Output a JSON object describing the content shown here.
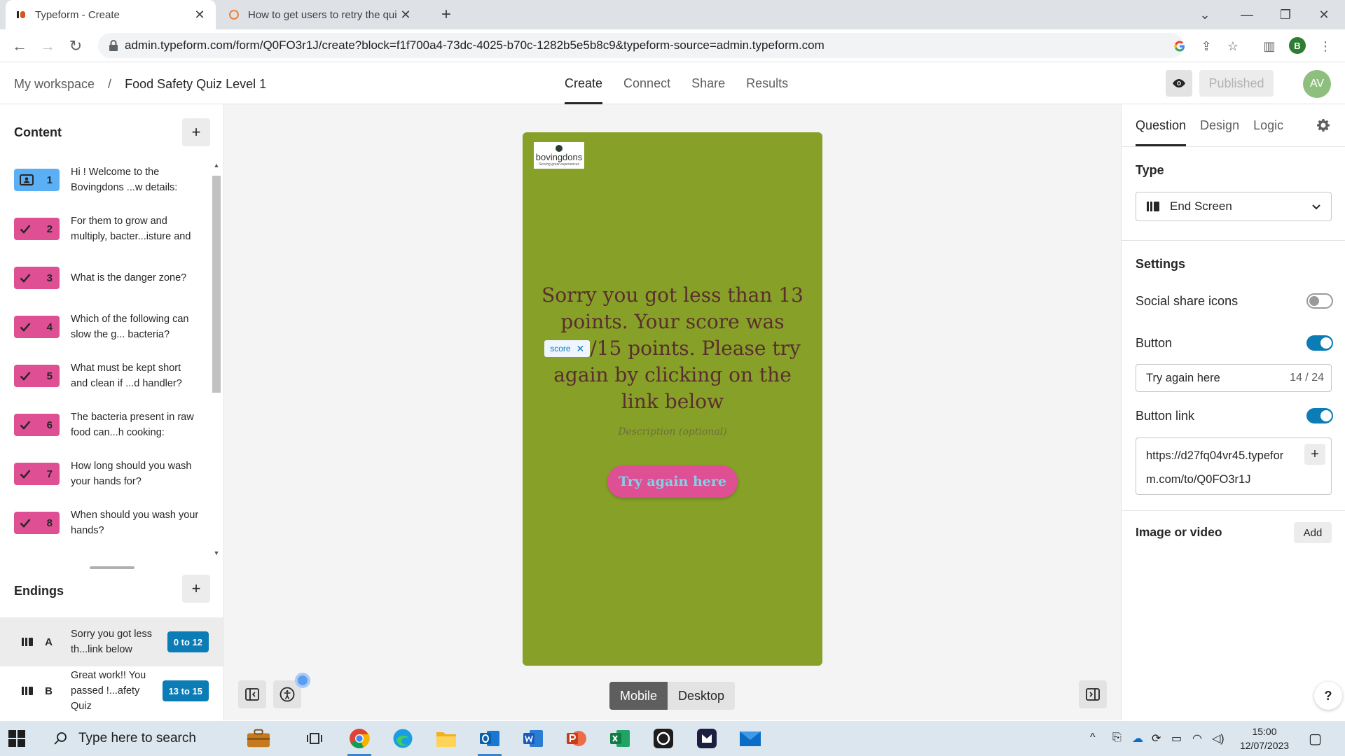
{
  "browser": {
    "tabs": [
      {
        "title": "Typeform - Create",
        "active": true
      },
      {
        "title": "How to get users to retry the qui",
        "active": false
      }
    ],
    "url": "admin.typeform.com/form/Q0FO3r1J/create?block=f1f700a4-73dc-4025-b70c-1282b5e5b8c9&typeform-source=admin.typeform.com",
    "profile_initial": "B"
  },
  "header": {
    "workspace": "My workspace",
    "separator": "/",
    "form_name": "Food Safety Quiz Level 1",
    "tabs": [
      "Create",
      "Connect",
      "Share",
      "Results"
    ],
    "active_tab": "Create",
    "published_label": "Published",
    "avatar_initials": "AV"
  },
  "content": {
    "heading": "Content",
    "add_label": "+",
    "questions": [
      {
        "num": "1",
        "text": "Hi ! Welcome to the Bovingdons ...w details:",
        "kind": "contact"
      },
      {
        "num": "2",
        "text": "For them to grow and multiply, bacter...isture and",
        "kind": "check"
      },
      {
        "num": "3",
        "text": "What is the danger zone?",
        "kind": "check"
      },
      {
        "num": "4",
        "text": "Which of the following can slow the g... bacteria?",
        "kind": "check"
      },
      {
        "num": "5",
        "text": "What must be kept short and clean if ...d handler?",
        "kind": "check"
      },
      {
        "num": "6",
        "text": "The bacteria present in raw food can...h cooking:",
        "kind": "check"
      },
      {
        "num": "7",
        "text": "How long should you wash your hands for?",
        "kind": "check"
      },
      {
        "num": "8",
        "text": "When should you wash your hands?",
        "kind": "check"
      }
    ]
  },
  "endings": {
    "heading": "Endings",
    "add_label": "+",
    "items": [
      {
        "letter": "A",
        "text": "Sorry you got less th...link below",
        "range": "0 to 12"
      },
      {
        "letter": "B",
        "text": "Great work!! You passed !...afety Quiz",
        "range": "13 to 15"
      }
    ]
  },
  "preview": {
    "logo_text": "bovingdons",
    "logo_tagline": "Serving great experiences",
    "line1": "Sorry you got less than 13 points. Your score was",
    "score_chip": "score",
    "line2": "/15 points.",
    "line3": "Please try again by clicking on the link below",
    "description_placeholder": "Description (optional)",
    "button_label": "Try again here",
    "background_color": "#86a028",
    "button_color": "#de4f94"
  },
  "view_toggle": {
    "mobile": "Mobile",
    "desktop": "Desktop",
    "selected": "Mobile"
  },
  "right_panel": {
    "tabs": [
      "Question",
      "Design",
      "Logic"
    ],
    "active_tab": "Question",
    "type_label": "Type",
    "type_value": "End Screen",
    "settings_label": "Settings",
    "social_share_label": "Social share icons",
    "social_share_on": false,
    "button_label": "Button",
    "button_on": true,
    "button_text_value": "Try again here",
    "button_text_counter": "14 / 24",
    "button_link_label": "Button link",
    "button_link_on": true,
    "button_link_value": "https://d27fq04vr45.typeform.com/to/Q0FO3r1J",
    "image_video_label": "Image or video",
    "add_label": "Add",
    "help_label": "?"
  },
  "taskbar": {
    "search_placeholder": "Type here to search",
    "time": "15:00",
    "date": "12/07/2023"
  }
}
